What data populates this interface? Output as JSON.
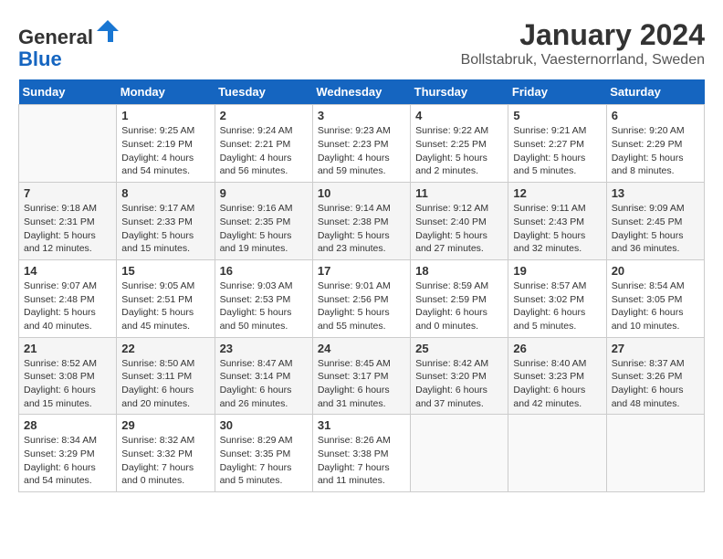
{
  "header": {
    "logo_line1": "General",
    "logo_line2": "Blue",
    "main_title": "January 2024",
    "subtitle": "Bollstabruk, Vaesternorrland, Sweden"
  },
  "calendar": {
    "days_of_week": [
      "Sunday",
      "Monday",
      "Tuesday",
      "Wednesday",
      "Thursday",
      "Friday",
      "Saturday"
    ],
    "weeks": [
      [
        {
          "day": "",
          "info": ""
        },
        {
          "day": "1",
          "info": "Sunrise: 9:25 AM\nSunset: 2:19 PM\nDaylight: 4 hours\nand 54 minutes."
        },
        {
          "day": "2",
          "info": "Sunrise: 9:24 AM\nSunset: 2:21 PM\nDaylight: 4 hours\nand 56 minutes."
        },
        {
          "day": "3",
          "info": "Sunrise: 9:23 AM\nSunset: 2:23 PM\nDaylight: 4 hours\nand 59 minutes."
        },
        {
          "day": "4",
          "info": "Sunrise: 9:22 AM\nSunset: 2:25 PM\nDaylight: 5 hours\nand 2 minutes."
        },
        {
          "day": "5",
          "info": "Sunrise: 9:21 AM\nSunset: 2:27 PM\nDaylight: 5 hours\nand 5 minutes."
        },
        {
          "day": "6",
          "info": "Sunrise: 9:20 AM\nSunset: 2:29 PM\nDaylight: 5 hours\nand 8 minutes."
        }
      ],
      [
        {
          "day": "7",
          "info": "Sunrise: 9:18 AM\nSunset: 2:31 PM\nDaylight: 5 hours\nand 12 minutes."
        },
        {
          "day": "8",
          "info": "Sunrise: 9:17 AM\nSunset: 2:33 PM\nDaylight: 5 hours\nand 15 minutes."
        },
        {
          "day": "9",
          "info": "Sunrise: 9:16 AM\nSunset: 2:35 PM\nDaylight: 5 hours\nand 19 minutes."
        },
        {
          "day": "10",
          "info": "Sunrise: 9:14 AM\nSunset: 2:38 PM\nDaylight: 5 hours\nand 23 minutes."
        },
        {
          "day": "11",
          "info": "Sunrise: 9:12 AM\nSunset: 2:40 PM\nDaylight: 5 hours\nand 27 minutes."
        },
        {
          "day": "12",
          "info": "Sunrise: 9:11 AM\nSunset: 2:43 PM\nDaylight: 5 hours\nand 32 minutes."
        },
        {
          "day": "13",
          "info": "Sunrise: 9:09 AM\nSunset: 2:45 PM\nDaylight: 5 hours\nand 36 minutes."
        }
      ],
      [
        {
          "day": "14",
          "info": "Sunrise: 9:07 AM\nSunset: 2:48 PM\nDaylight: 5 hours\nand 40 minutes."
        },
        {
          "day": "15",
          "info": "Sunrise: 9:05 AM\nSunset: 2:51 PM\nDaylight: 5 hours\nand 45 minutes."
        },
        {
          "day": "16",
          "info": "Sunrise: 9:03 AM\nSunset: 2:53 PM\nDaylight: 5 hours\nand 50 minutes."
        },
        {
          "day": "17",
          "info": "Sunrise: 9:01 AM\nSunset: 2:56 PM\nDaylight: 5 hours\nand 55 minutes."
        },
        {
          "day": "18",
          "info": "Sunrise: 8:59 AM\nSunset: 2:59 PM\nDaylight: 6 hours\nand 0 minutes."
        },
        {
          "day": "19",
          "info": "Sunrise: 8:57 AM\nSunset: 3:02 PM\nDaylight: 6 hours\nand 5 minutes."
        },
        {
          "day": "20",
          "info": "Sunrise: 8:54 AM\nSunset: 3:05 PM\nDaylight: 6 hours\nand 10 minutes."
        }
      ],
      [
        {
          "day": "21",
          "info": "Sunrise: 8:52 AM\nSunset: 3:08 PM\nDaylight: 6 hours\nand 15 minutes."
        },
        {
          "day": "22",
          "info": "Sunrise: 8:50 AM\nSunset: 3:11 PM\nDaylight: 6 hours\nand 20 minutes."
        },
        {
          "day": "23",
          "info": "Sunrise: 8:47 AM\nSunset: 3:14 PM\nDaylight: 6 hours\nand 26 minutes."
        },
        {
          "day": "24",
          "info": "Sunrise: 8:45 AM\nSunset: 3:17 PM\nDaylight: 6 hours\nand 31 minutes."
        },
        {
          "day": "25",
          "info": "Sunrise: 8:42 AM\nSunset: 3:20 PM\nDaylight: 6 hours\nand 37 minutes."
        },
        {
          "day": "26",
          "info": "Sunrise: 8:40 AM\nSunset: 3:23 PM\nDaylight: 6 hours\nand 42 minutes."
        },
        {
          "day": "27",
          "info": "Sunrise: 8:37 AM\nSunset: 3:26 PM\nDaylight: 6 hours\nand 48 minutes."
        }
      ],
      [
        {
          "day": "28",
          "info": "Sunrise: 8:34 AM\nSunset: 3:29 PM\nDaylight: 6 hours\nand 54 minutes."
        },
        {
          "day": "29",
          "info": "Sunrise: 8:32 AM\nSunset: 3:32 PM\nDaylight: 7 hours\nand 0 minutes."
        },
        {
          "day": "30",
          "info": "Sunrise: 8:29 AM\nSunset: 3:35 PM\nDaylight: 7 hours\nand 5 minutes."
        },
        {
          "day": "31",
          "info": "Sunrise: 8:26 AM\nSunset: 3:38 PM\nDaylight: 7 hours\nand 11 minutes."
        },
        {
          "day": "",
          "info": ""
        },
        {
          "day": "",
          "info": ""
        },
        {
          "day": "",
          "info": ""
        }
      ]
    ]
  }
}
